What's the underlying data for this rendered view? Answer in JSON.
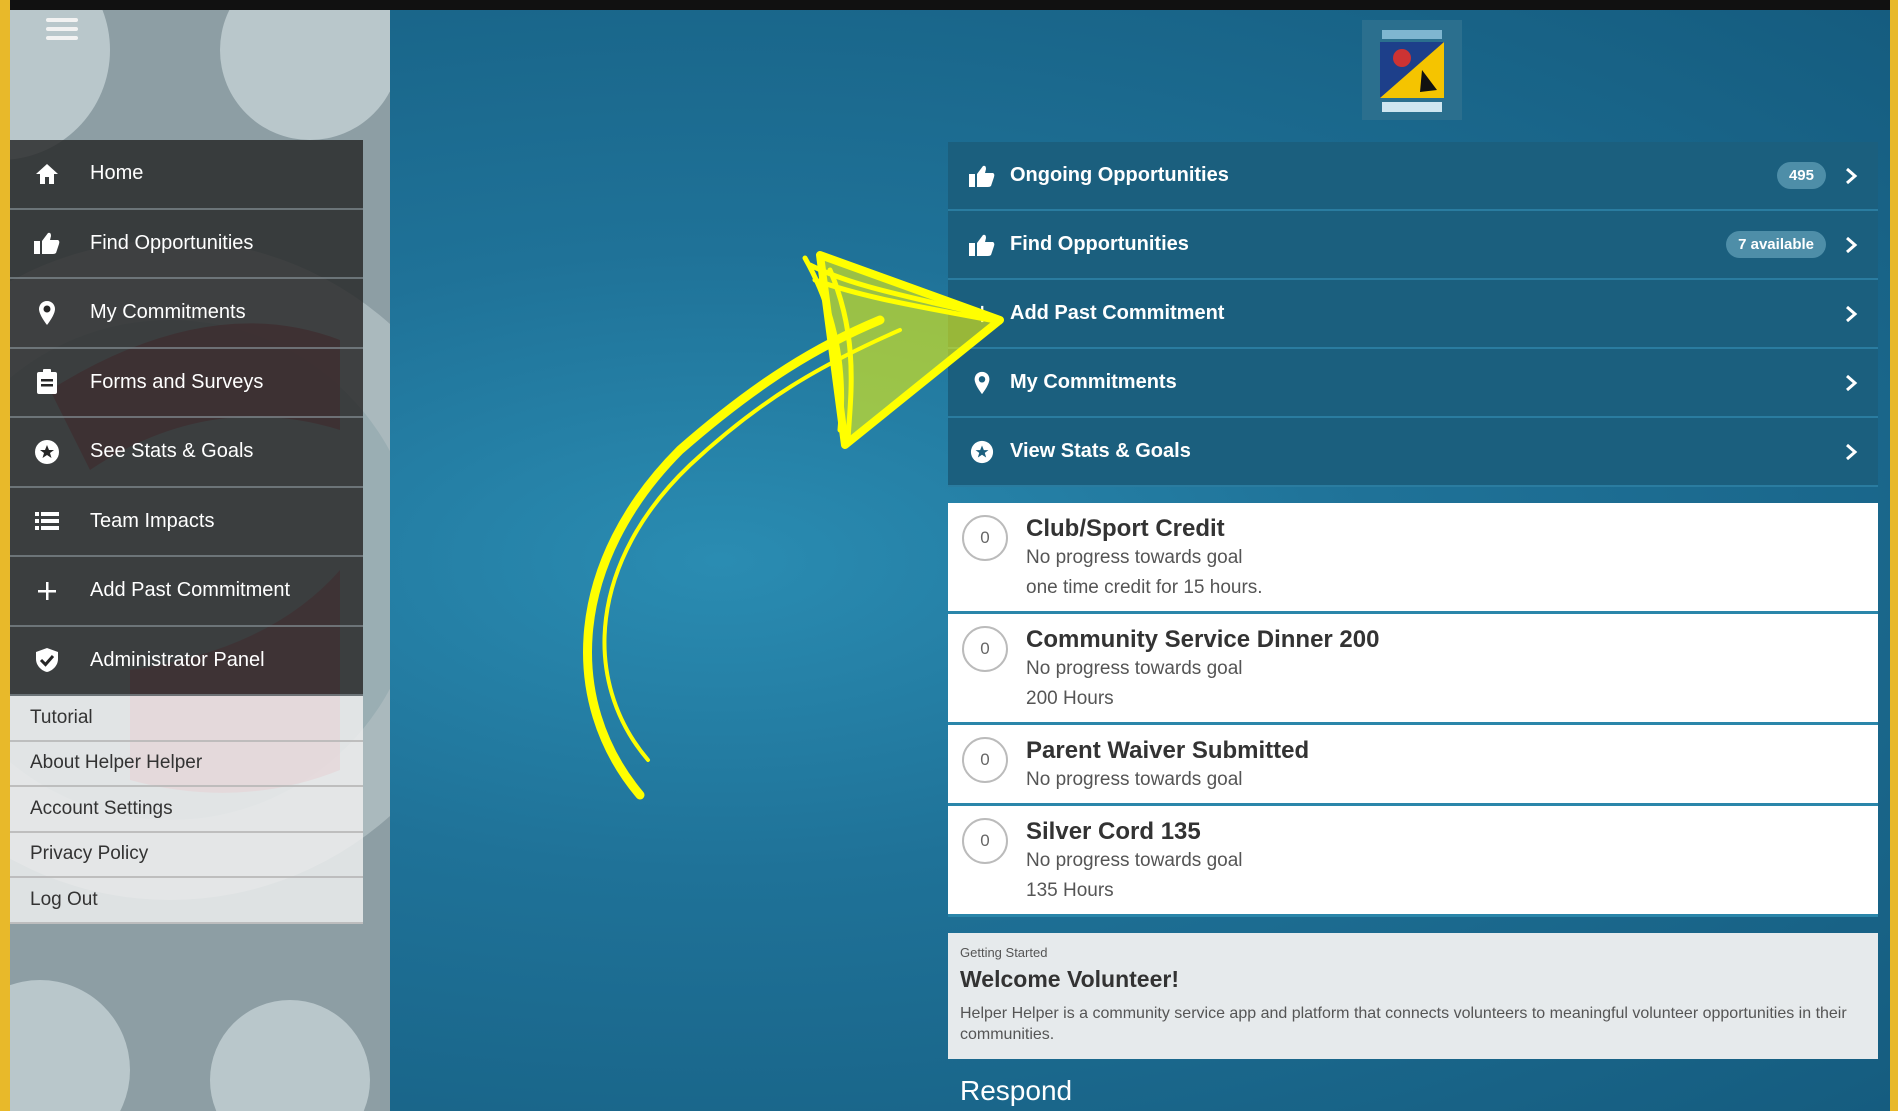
{
  "sidebar": {
    "nav_items": [
      {
        "label": "Home",
        "icon": "home-icon"
      },
      {
        "label": "Find Opportunities",
        "icon": "thumbs-up-icon"
      },
      {
        "label": "My Commitments",
        "icon": "map-pin-icon"
      },
      {
        "label": "Forms and Surveys",
        "icon": "clipboard-icon"
      },
      {
        "label": "See Stats & Goals",
        "icon": "star-circle-icon"
      },
      {
        "label": "Team Impacts",
        "icon": "list-icon"
      },
      {
        "label": "Add Past Commitment",
        "icon": "plus-icon"
      },
      {
        "label": "Administrator Panel",
        "icon": "shield-check-icon"
      }
    ],
    "secondary_items": [
      "Tutorial",
      "About Helper Helper",
      "Account Settings",
      "Privacy Policy",
      "Log Out"
    ]
  },
  "main": {
    "menu": [
      {
        "label": "Ongoing Opportunities",
        "icon": "thumbs-up-icon",
        "badge": "495"
      },
      {
        "label": "Find Opportunities",
        "icon": "thumbs-up-icon",
        "badge": "7 available"
      },
      {
        "label": "Add Past Commitment",
        "icon": "plus-icon",
        "badge": ""
      },
      {
        "label": "My Commitments",
        "icon": "map-pin-icon",
        "badge": ""
      },
      {
        "label": "View Stats & Goals",
        "icon": "star-circle-icon",
        "badge": ""
      }
    ],
    "goals": [
      {
        "count": "0",
        "title": "Club/Sport Credit",
        "status": "No progress towards goal",
        "detail": "one time credit for 15 hours."
      },
      {
        "count": "0",
        "title": "Community Service Dinner 200",
        "status": "No progress towards goal",
        "detail": "200 Hours"
      },
      {
        "count": "0",
        "title": "Parent Waiver Submitted",
        "status": "No progress towards goal",
        "detail": ""
      },
      {
        "count": "0",
        "title": "Silver Cord 135",
        "status": "No progress towards goal",
        "detail": "135 Hours"
      }
    ],
    "welcome": {
      "kicker": "Getting Started",
      "title": "Welcome Volunteer!",
      "body": "Helper Helper is a community service app and platform that connects volunteers to meaningful volunteer opportunities in their communities."
    },
    "respond_heading": "Respond"
  },
  "colors": {
    "accent_yellow": "#ffff00",
    "menu_bg": "#1b5f7e",
    "main_bg": "#1f7298",
    "sidebar_dark": "#262626",
    "frame": "#e8b92a"
  }
}
